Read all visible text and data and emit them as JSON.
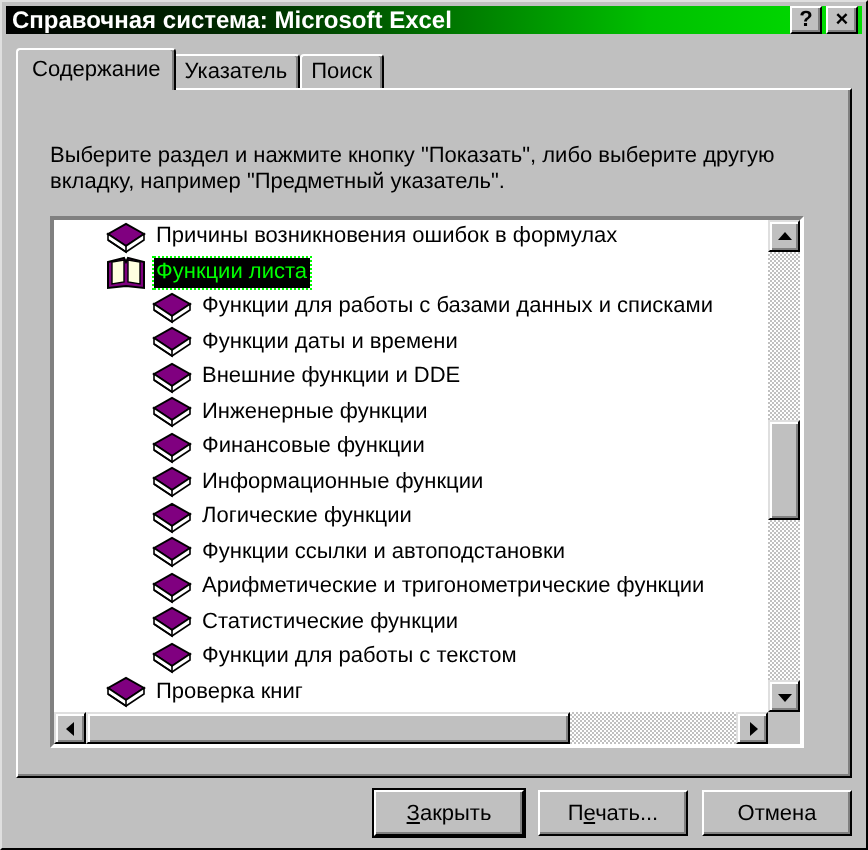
{
  "window": {
    "title": "Справочная система: Microsoft Excel",
    "controls": [
      "?",
      "×"
    ]
  },
  "tabs": [
    {
      "label": "Содержание",
      "selected": true
    },
    {
      "label": "Указатель",
      "selected": false
    },
    {
      "label": "Поиск",
      "selected": false
    }
  ],
  "instructions": "Выберите раздел и нажмите кнопку \"Показать\", либо выберите другую вкладку, например \"Предметный указатель\".",
  "tree": [
    {
      "label": "Причины возникновения ошибок в формулах",
      "expanded": false,
      "selected": false
    },
    {
      "label": "Функции листа",
      "expanded": true,
      "selected": true,
      "children": [
        {
          "label": "Функции для работы с базами данных и списками",
          "expanded": false,
          "selected": false
        },
        {
          "label": "Функции даты и времени",
          "expanded": false,
          "selected": false
        },
        {
          "label": "Внешние функции и DDE",
          "expanded": false,
          "selected": false
        },
        {
          "label": "Инженерные функции",
          "expanded": false,
          "selected": false
        },
        {
          "label": "Финансовые функции",
          "expanded": false,
          "selected": false
        },
        {
          "label": "Информационные функции",
          "expanded": false,
          "selected": false
        },
        {
          "label": "Логические функции",
          "expanded": false,
          "selected": false
        },
        {
          "label": "Функции ссылки и автоподстановки",
          "expanded": false,
          "selected": false
        },
        {
          "label": "Арифметические и тригонометрические функции",
          "expanded": false,
          "selected": false
        },
        {
          "label": "Статистические функции",
          "expanded": false,
          "selected": false
        },
        {
          "label": "Функции для работы с текстом",
          "expanded": false,
          "selected": false
        }
      ]
    },
    {
      "label": "Проверка книг",
      "expanded": false,
      "selected": false
    }
  ],
  "buttons": [
    {
      "parts": [
        {
          "text": "З",
          "underlined": true
        },
        {
          "text": "акрыть",
          "underlined": false
        }
      ],
      "default": true
    },
    {
      "parts": [
        {
          "text": "П",
          "underlined": false
        },
        {
          "text": "е",
          "underlined": true
        },
        {
          "text": "чать...",
          "underlined": false
        }
      ],
      "default": false
    },
    {
      "parts": [
        {
          "text": "Отмена",
          "underlined": false
        }
      ],
      "default": false
    }
  ]
}
